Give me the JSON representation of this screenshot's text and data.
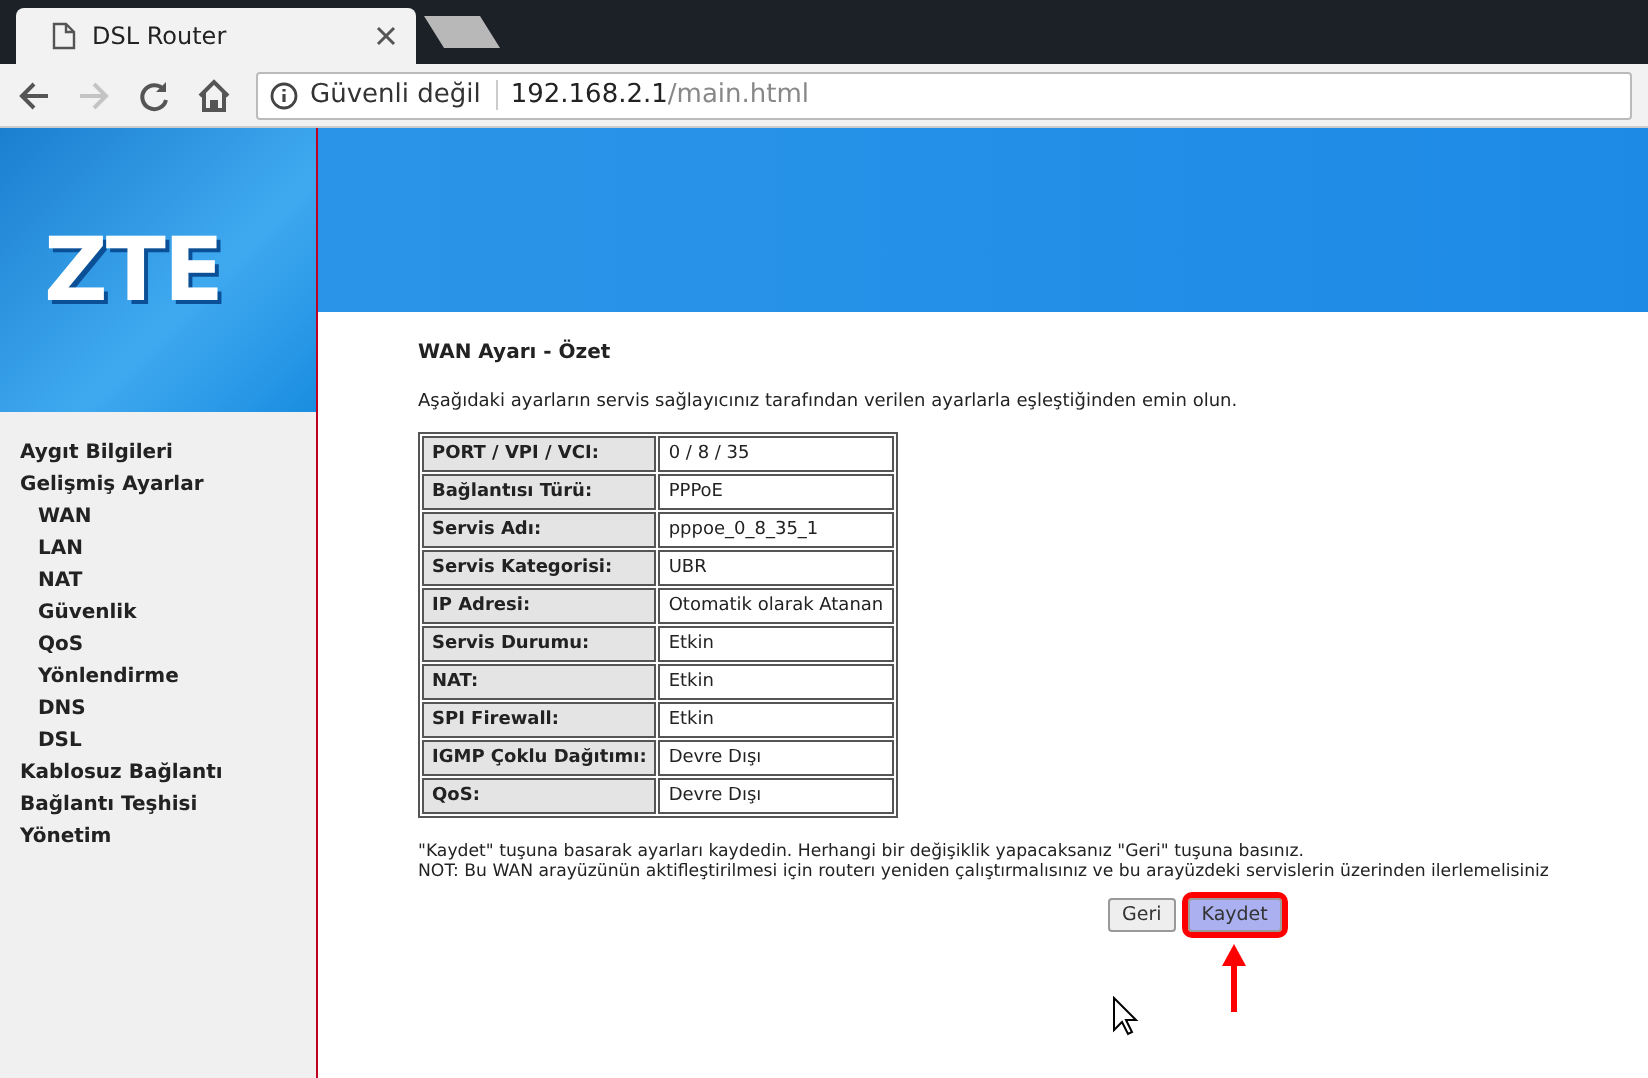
{
  "browser": {
    "tab_title": "DSL Router",
    "logo": "ZTE",
    "security_label": "Güvenli değil",
    "url_host": "192.168.2.1",
    "url_path": "/main.html"
  },
  "sidebar": {
    "items": [
      {
        "label": "Aygıt Bilgileri"
      },
      {
        "label": "Gelişmiş Ayarlar",
        "children": [
          {
            "label": "WAN"
          },
          {
            "label": "LAN"
          },
          {
            "label": "NAT"
          },
          {
            "label": "Güvenlik"
          },
          {
            "label": "QoS"
          },
          {
            "label": "Yönlendirme"
          },
          {
            "label": "DNS"
          },
          {
            "label": "DSL"
          }
        ]
      },
      {
        "label": "Kablosuz Bağlantı"
      },
      {
        "label": "Bağlantı Teşhisi"
      },
      {
        "label": "Yönetim"
      }
    ]
  },
  "content": {
    "title": "WAN Ayarı - Özet",
    "intro": "Aşağıdaki ayarların servis sağlayıcınız tarafından verilen ayarlarla eşleştiğinden emin olun.",
    "table": {
      "rows": [
        {
          "label": "PORT / VPI / VCI:",
          "value": "0 / 8 / 35"
        },
        {
          "label": "Bağlantısı Türü:",
          "value": "PPPoE"
        },
        {
          "label": "Servis Adı:",
          "value": "pppoe_0_8_35_1"
        },
        {
          "label": "Servis Kategorisi:",
          "value": "UBR"
        },
        {
          "label": "IP Adresi:",
          "value": "Otomatik olarak Atanan"
        },
        {
          "label": "Servis Durumu:",
          "value": "Etkin"
        },
        {
          "label": "NAT:",
          "value": "Etkin"
        },
        {
          "label": "SPI Firewall:",
          "value": "Etkin"
        },
        {
          "label": "IGMP Çoklu Dağıtımı:",
          "value": "Devre Dışı"
        },
        {
          "label": "QoS:",
          "value": "Devre Dışı"
        }
      ]
    },
    "notes": [
      "\"Kaydet\" tuşuna basarak ayarları kaydedin. Herhangi bir değişiklik yapacaksanız \"Geri\" tuşuna basınız.",
      "NOT: Bu WAN arayüzünün aktifleştirilmesi için routerı yeniden çalıştırmalısınız ve bu arayüzdeki servislerin üzerinden ilerlemelisiniz"
    ],
    "buttons": [
      {
        "label": "Geri",
        "kind": "default",
        "highlighted": false
      },
      {
        "label": "Kaydet",
        "kind": "primary",
        "highlighted": true
      }
    ]
  }
}
